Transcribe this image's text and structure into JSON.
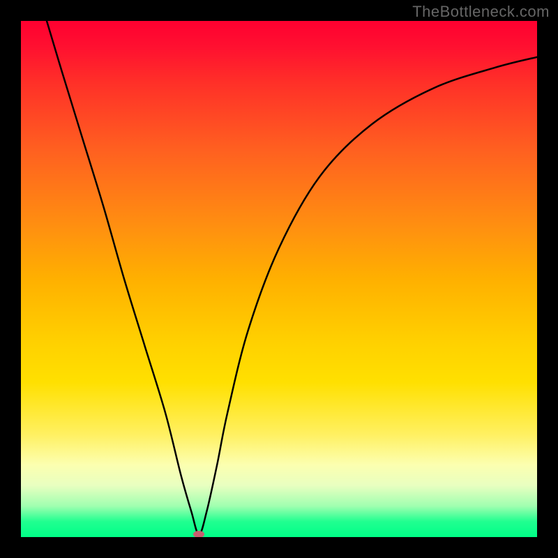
{
  "watermark": "TheBottleneck.com",
  "chart_data": {
    "type": "line",
    "title": "",
    "xlabel": "",
    "ylabel": "",
    "xlim": [
      0,
      100
    ],
    "ylim": [
      0,
      100
    ],
    "grid": false,
    "legend": false,
    "background_gradient": {
      "top": "#ff0033",
      "middle": "#ffd000",
      "bottom": "#00ff88"
    },
    "series": [
      {
        "name": "bottleneck-curve",
        "x": [
          5,
          8,
          12,
          16,
          20,
          24,
          28,
          31,
          33,
          34.5,
          36,
          38,
          40,
          44,
          50,
          58,
          68,
          80,
          92,
          100
        ],
        "y": [
          100,
          90,
          77,
          64,
          50,
          37,
          24,
          12,
          5,
          0.5,
          5,
          14,
          24,
          40,
          56,
          70,
          80,
          87,
          91,
          93
        ]
      }
    ],
    "marker": {
      "x": 34.5,
      "y": 0.5,
      "color": "#c86070"
    }
  }
}
